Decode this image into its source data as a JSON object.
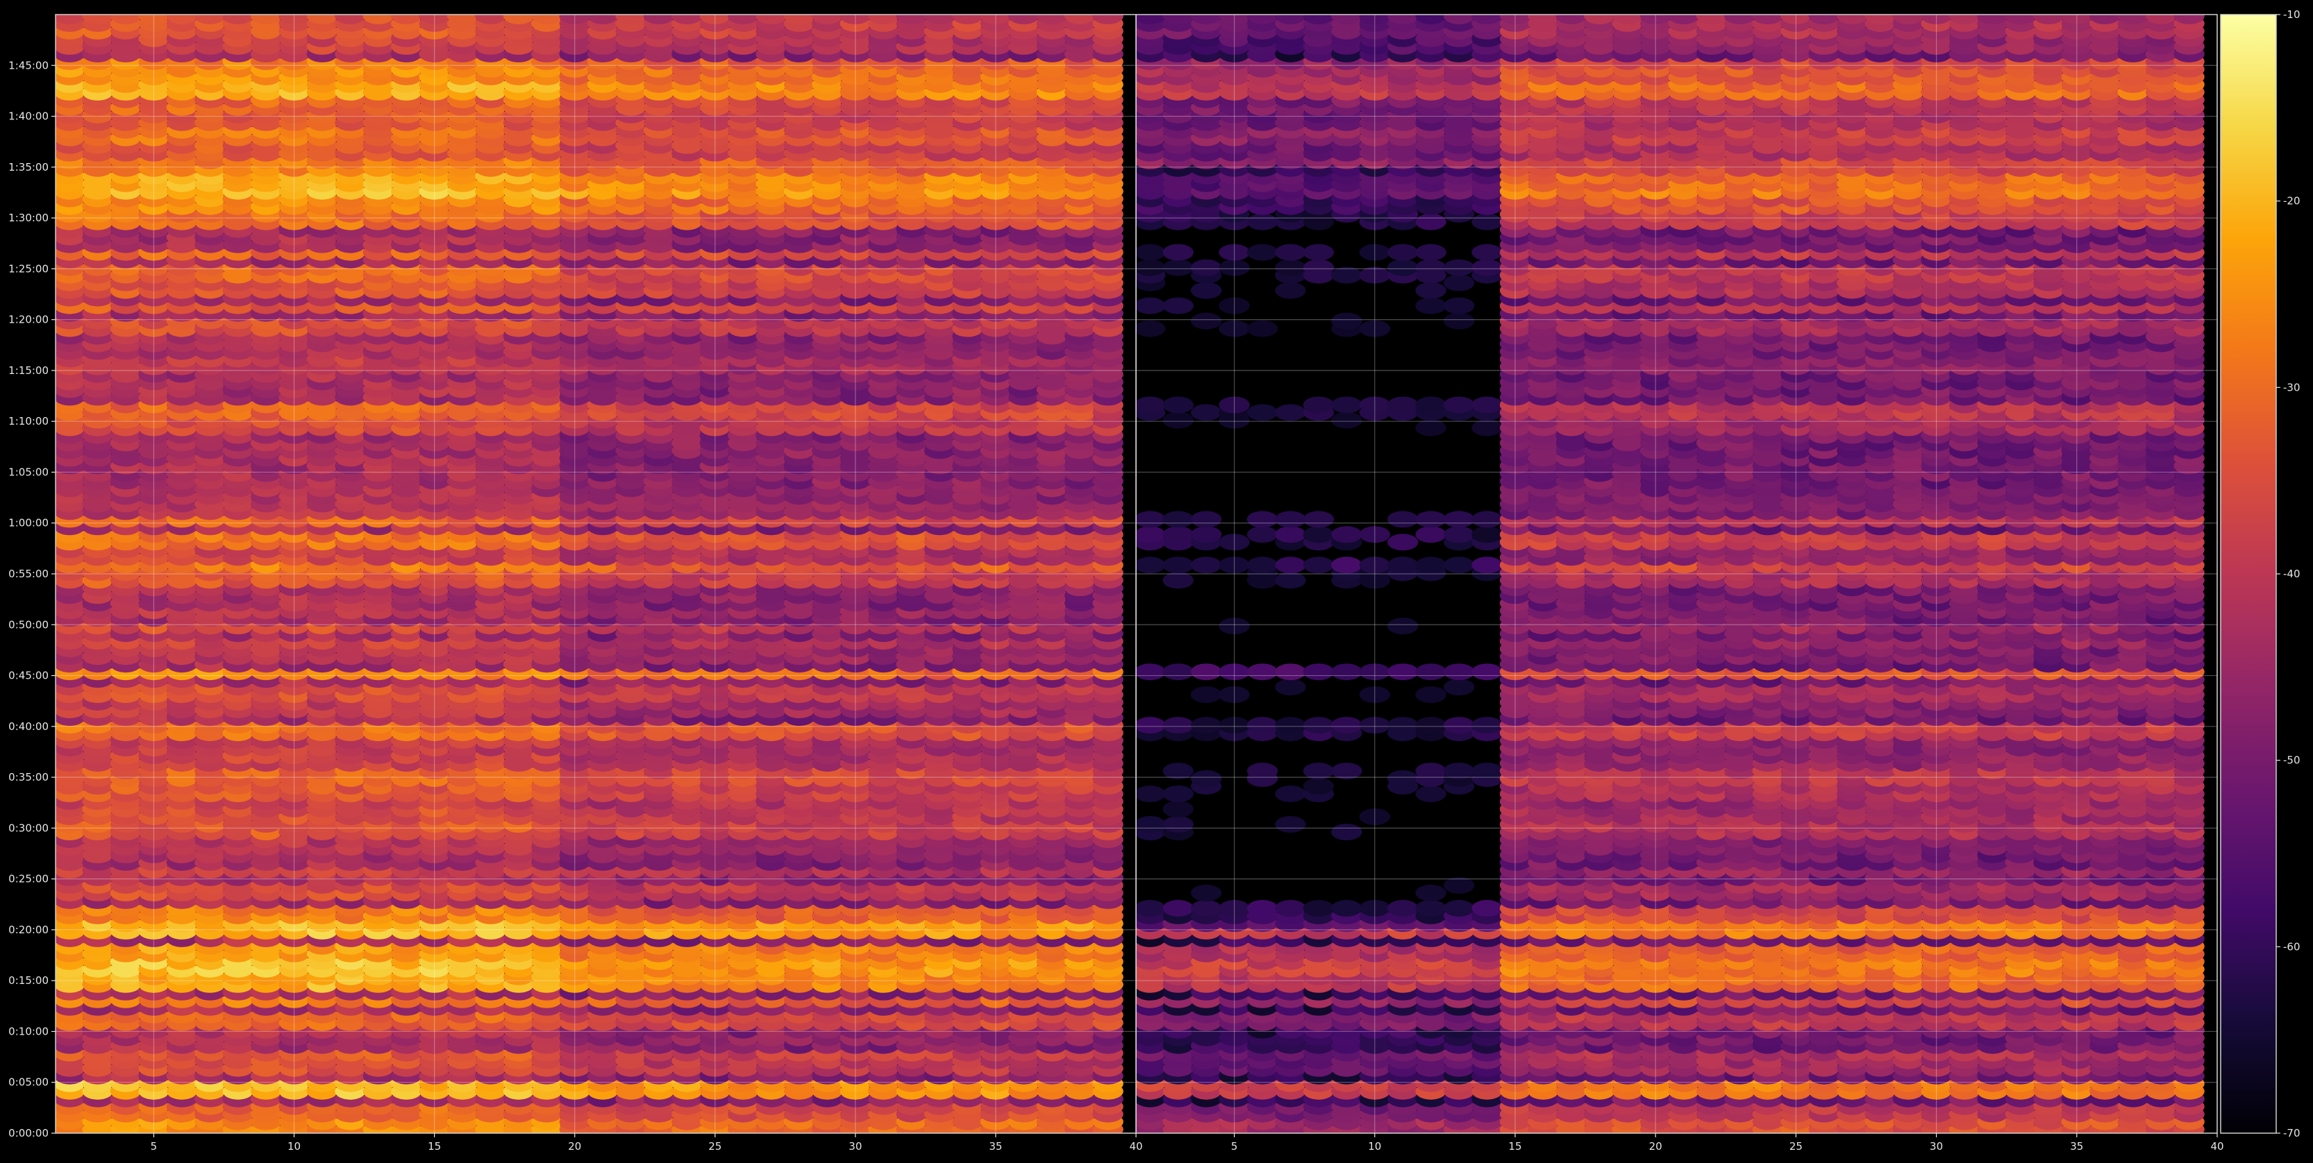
{
  "chart_data": {
    "type": "heatmap",
    "title": "",
    "xlabel": "",
    "ylabel": "",
    "colormap": "inferno",
    "background": "#000000",
    "grid": true,
    "y_range": [
      0,
      6600
    ],
    "y_unit": "seconds",
    "y_ticks": [
      0,
      300,
      600,
      900,
      1200,
      1500,
      1800,
      2100,
      2400,
      2700,
      3000,
      3300,
      3600,
      3900,
      4200,
      4500,
      4800,
      5100,
      5400,
      5700,
      6000,
      6300
    ],
    "y_tick_labels": [
      "0:00:00",
      "0:05:00",
      "0:10:00",
      "0:15:00",
      "0:20:00",
      "0:25:00",
      "0:30:00",
      "0:35:00",
      "0:40:00",
      "0:45:00",
      "0:50:00",
      "0:55:00",
      "1:00:00",
      "1:05:00",
      "1:10:00",
      "1:15:00",
      "1:20:00",
      "1:25:00",
      "1:30:00",
      "1:35:00",
      "1:40:00",
      "1:45:00"
    ],
    "panels": [
      {
        "name": "left",
        "x_range": [
          1.5,
          40
        ],
        "x_ticks": [
          5,
          10,
          15,
          20,
          25,
          30,
          35,
          40
        ],
        "x_tick_labels": [
          "5",
          "10",
          "15",
          "20",
          "25",
          "30",
          "35",
          "40"
        ],
        "cell_x_values": [
          2,
          3,
          4,
          5,
          6,
          7,
          8,
          9,
          10,
          11,
          12,
          13,
          14,
          15,
          16,
          17,
          18,
          19,
          20,
          21,
          22,
          23,
          24,
          25,
          26,
          27,
          28,
          29,
          30,
          31,
          32,
          33,
          34,
          35,
          36,
          37,
          38,
          39
        ],
        "base_level_db": -45
      },
      {
        "name": "right",
        "x_range": [
          1.5,
          40
        ],
        "x_ticks": [
          5,
          10,
          15,
          20,
          25,
          30,
          35,
          40
        ],
        "x_tick_labels": [
          "5",
          "10",
          "15",
          "20",
          "25",
          "30",
          "35",
          "40"
        ],
        "cell_x_values": [
          2,
          3,
          4,
          5,
          6,
          7,
          8,
          9,
          10,
          11,
          12,
          13,
          14,
          15,
          16,
          17,
          18,
          19,
          20,
          21,
          22,
          23,
          24,
          25,
          26,
          27,
          28,
          29,
          30,
          31,
          32,
          33,
          34,
          35,
          36,
          37,
          38,
          39
        ],
        "base_level_db": -50,
        "dark_region_x": [
          9,
          15
        ],
        "dark_region_y": [
          1200,
          5700
        ]
      }
    ],
    "bands": [
      {
        "t": 35,
        "level": -28
      },
      {
        "t": 130,
        "level": -34
      },
      {
        "t": 255,
        "level": -22
      },
      {
        "t": 390,
        "level": -38
      },
      {
        "t": 470,
        "level": -36
      },
      {
        "t": 600,
        "level": -48
      },
      {
        "t": 690,
        "level": -34
      },
      {
        "t": 790,
        "level": -30
      },
      {
        "t": 900,
        "level": -24
      },
      {
        "t": 990,
        "level": -22
      },
      {
        "t": 1090,
        "level": -26
      },
      {
        "t": 1200,
        "level": -22
      },
      {
        "t": 1300,
        "level": -30
      },
      {
        "t": 1450,
        "level": -38
      },
      {
        "t": 1550,
        "level": -40
      },
      {
        "t": 1650,
        "level": -48
      },
      {
        "t": 1720,
        "level": -44
      },
      {
        "t": 1800,
        "level": -36
      },
      {
        "t": 1880,
        "level": -38
      },
      {
        "t": 1960,
        "level": -40
      },
      {
        "t": 2040,
        "level": -36
      },
      {
        "t": 2120,
        "level": -34
      },
      {
        "t": 2210,
        "level": -40
      },
      {
        "t": 2300,
        "level": -42
      },
      {
        "t": 2400,
        "level": -32
      },
      {
        "t": 2530,
        "level": -42
      },
      {
        "t": 2620,
        "level": -38
      },
      {
        "t": 2720,
        "level": -28
      },
      {
        "t": 2820,
        "level": -44
      },
      {
        "t": 2900,
        "level": -40
      },
      {
        "t": 2990,
        "level": -38
      },
      {
        "t": 3080,
        "level": -44
      },
      {
        "t": 3180,
        "level": -48
      },
      {
        "t": 3270,
        "level": -36
      },
      {
        "t": 3350,
        "level": -30
      },
      {
        "t": 3430,
        "level": -40
      },
      {
        "t": 3520,
        "level": -32
      },
      {
        "t": 3620,
        "level": -34
      },
      {
        "t": 3690,
        "level": -44
      },
      {
        "t": 3780,
        "level": -46
      },
      {
        "t": 3870,
        "level": -48
      },
      {
        "t": 3970,
        "level": -52
      },
      {
        "t": 4090,
        "level": -52
      },
      {
        "t": 4200,
        "level": -38
      },
      {
        "t": 4280,
        "level": -34
      },
      {
        "t": 4400,
        "level": -48
      },
      {
        "t": 4540,
        "level": -42
      },
      {
        "t": 4650,
        "level": -46
      },
      {
        "t": 4780,
        "level": -38
      },
      {
        "t": 4880,
        "level": -36
      },
      {
        "t": 5010,
        "level": -36
      },
      {
        "t": 5100,
        "level": -34
      },
      {
        "t": 5200,
        "level": -34
      },
      {
        "t": 5390,
        "level": -32
      },
      {
        "t": 5480,
        "level": -28
      },
      {
        "t": 5560,
        "level": -22
      },
      {
        "t": 5640,
        "level": -24
      },
      {
        "t": 5720,
        "level": -30
      },
      {
        "t": 5800,
        "level": -36
      },
      {
        "t": 5880,
        "level": -32
      },
      {
        "t": 5980,
        "level": -36
      },
      {
        "t": 6060,
        "level": -34
      },
      {
        "t": 6150,
        "level": -24
      },
      {
        "t": 6240,
        "level": -28
      },
      {
        "t": 6320,
        "level": -30
      },
      {
        "t": 6420,
        "level": -40
      },
      {
        "t": 6520,
        "level": -36
      },
      {
        "t": 6580,
        "level": -38
      }
    ],
    "colorbar": {
      "range": [
        -70,
        -10
      ],
      "ticks": [
        -70,
        -60,
        -50,
        -40,
        -30,
        -20,
        -10
      ],
      "tick_labels": [
        "-70",
        "-60",
        "-50",
        "-40",
        "-30",
        "-20",
        "-10"
      ]
    }
  }
}
